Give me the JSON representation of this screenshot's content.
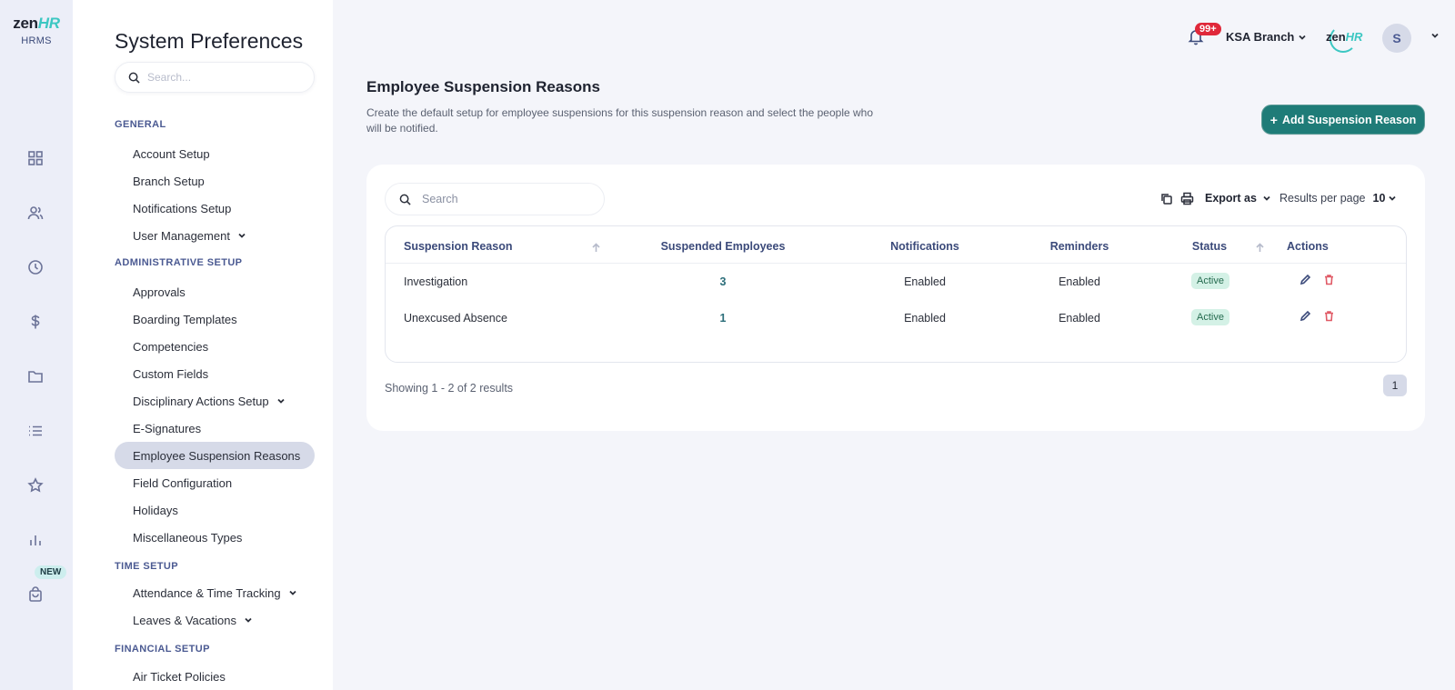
{
  "brand": {
    "logo_main": "zen",
    "logo_accent": "HR",
    "logo_sub": "HRMS",
    "accent_color": "#1f7c78"
  },
  "rail": {
    "icons": [
      "dashboard-icon",
      "people-icon",
      "clock-icon",
      "dollar-icon",
      "folder-icon",
      "list-icon",
      "star-icon",
      "bar-chart-icon",
      "bag-icon"
    ],
    "new_badge": "NEW"
  },
  "sidebar": {
    "title": "System Preferences",
    "search_placeholder": "Search...",
    "sections": {
      "general": {
        "label": "GENERAL",
        "items": [
          "Account Setup",
          "Branch Setup",
          "Notifications Setup",
          "User Management"
        ]
      },
      "administrative": {
        "label": "ADMINISTRATIVE SETUP",
        "items": [
          "Approvals",
          "Boarding Templates",
          "Competencies",
          "Custom Fields",
          "Disciplinary Actions Setup",
          "E-Signatures",
          "Employee Suspension Reasons",
          "Field Configuration",
          "Holidays",
          "Miscellaneous Types"
        ]
      },
      "time": {
        "label": "TIME SETUP",
        "items": [
          "Attendance & Time Tracking",
          "Leaves & Vacations"
        ]
      },
      "financial": {
        "label": "FINANCIAL SETUP",
        "items": [
          "Air Ticket Policies"
        ]
      }
    },
    "active_item": "Employee Suspension Reasons"
  },
  "topbar": {
    "notification_count": "99+",
    "branch": "KSA Branch",
    "mini_logo_main": "zen",
    "mini_logo_accent": "HR",
    "avatar_initial": "S"
  },
  "page": {
    "title": "Employee Suspension Reasons",
    "description": "Create the default setup for employee suspensions for this suspension reason and select the people who will be notified.",
    "add_button": "Add Suspension Reason"
  },
  "table": {
    "search_placeholder": "Search",
    "export_label": "Export as",
    "results_per_page_label": "Results per page",
    "results_per_page_value": "10",
    "columns": [
      "Suspension Reason",
      "Suspended Employees",
      "Notifications",
      "Reminders",
      "Status",
      "Actions"
    ],
    "rows": [
      {
        "reason": "Investigation",
        "employees": "3",
        "notifications": "Enabled",
        "reminders": "Enabled",
        "status": "Active"
      },
      {
        "reason": "Unexcused Absence",
        "employees": "1",
        "notifications": "Enabled",
        "reminders": "Enabled",
        "status": "Active"
      }
    ],
    "showing": "Showing 1 - 2 of 2 results",
    "current_page": "1"
  }
}
